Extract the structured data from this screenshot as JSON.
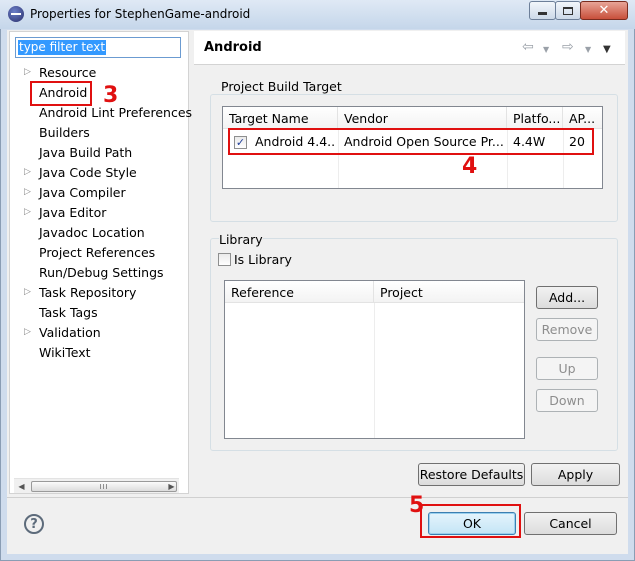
{
  "window": {
    "title": "Properties for StephenGame-android",
    "controls": {
      "minimize_icon": "minimize-icon",
      "maximize_icon": "maximize-icon",
      "close_glyph": "✕"
    }
  },
  "filter": {
    "value": "type filter text"
  },
  "tree": {
    "items": [
      {
        "label": "Resource",
        "expandable": true
      },
      {
        "label": "Android",
        "expandable": false
      },
      {
        "label": "Android Lint Preferences",
        "expandable": false
      },
      {
        "label": "Builders",
        "expandable": false
      },
      {
        "label": "Java Build Path",
        "expandable": false
      },
      {
        "label": "Java Code Style",
        "expandable": true
      },
      {
        "label": "Java Compiler",
        "expandable": true
      },
      {
        "label": "Java Editor",
        "expandable": true
      },
      {
        "label": "Javadoc Location",
        "expandable": false
      },
      {
        "label": "Project References",
        "expandable": false
      },
      {
        "label": "Run/Debug Settings",
        "expandable": false
      },
      {
        "label": "Task Repository",
        "expandable": true
      },
      {
        "label": "Task Tags",
        "expandable": false
      },
      {
        "label": "Validation",
        "expandable": true
      },
      {
        "label": "WikiText",
        "expandable": false
      }
    ],
    "scrollbar_grip": "III"
  },
  "page": {
    "title": "Android"
  },
  "build_target": {
    "group_title": "Project Build Target",
    "columns": [
      "Target Name",
      "Vendor",
      "Platfo...",
      "AP..."
    ],
    "rows": [
      {
        "checked": true,
        "check_glyph": "✓",
        "target": "Android 4.4...",
        "vendor": "Android Open Source Pr...",
        "platform": "4.4W",
        "api": "20"
      }
    ]
  },
  "library": {
    "group_title": "Library",
    "is_library_label": "Is Library",
    "columns": [
      "Reference",
      "Project"
    ],
    "buttons": {
      "add": "Add...",
      "remove": "Remove",
      "up": "Up",
      "down": "Down"
    }
  },
  "actions": {
    "restore_defaults": "Restore Defaults",
    "apply": "Apply",
    "ok": "OK",
    "cancel": "Cancel",
    "help_glyph": "?"
  },
  "annotations": {
    "step3": "3",
    "step4": "4",
    "step5": "5",
    "color": "#e01010"
  }
}
